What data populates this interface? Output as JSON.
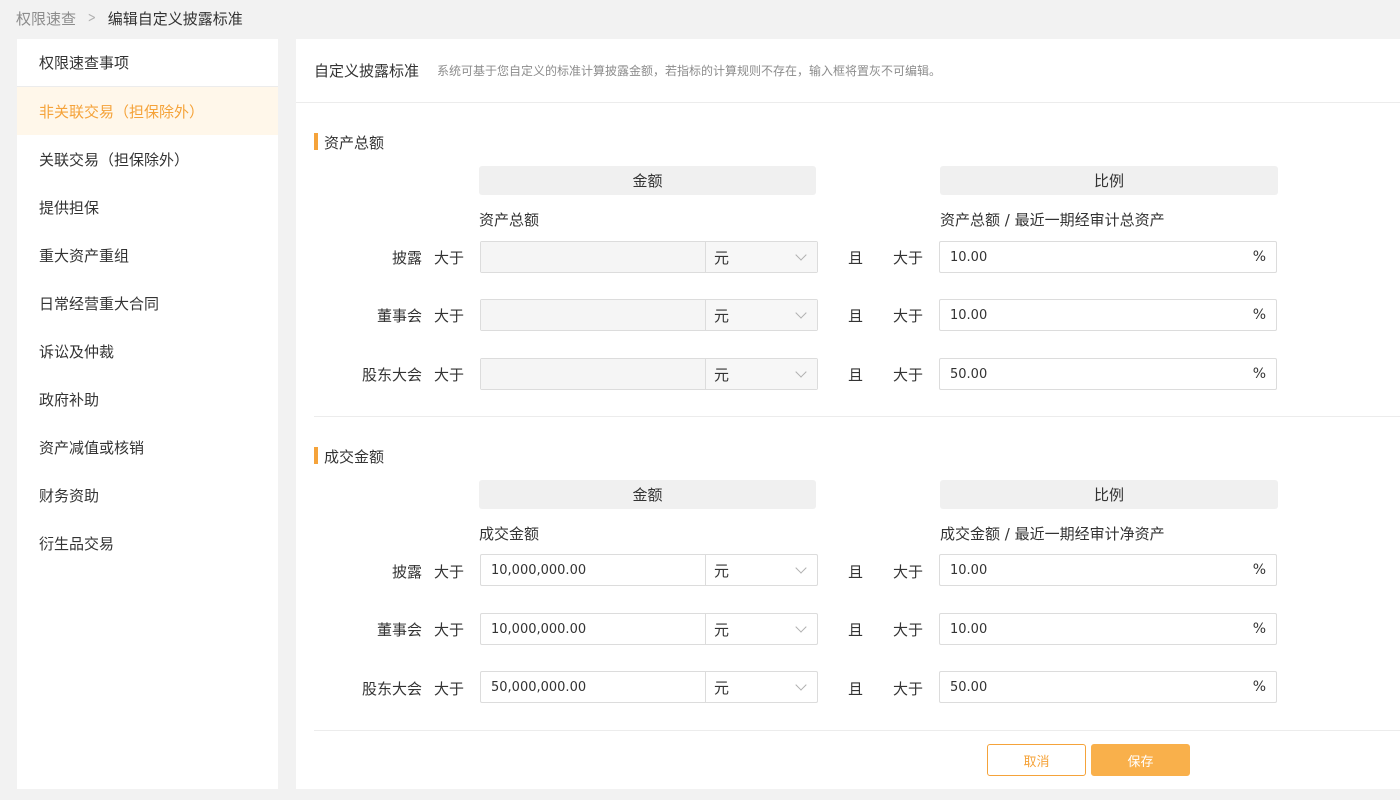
{
  "breadcrumb": {
    "parent": "权限速查",
    "current": "编辑自定义披露标准"
  },
  "sidebar": {
    "items": [
      {
        "label": "权限速查事项"
      },
      {
        "label": "非关联交易（担保除外）"
      },
      {
        "label": "关联交易（担保除外）"
      },
      {
        "label": "提供担保"
      },
      {
        "label": "重大资产重组"
      },
      {
        "label": "日常经营重大合同"
      },
      {
        "label": "诉讼及仲裁"
      },
      {
        "label": "政府补助"
      },
      {
        "label": "资产减值或核销"
      },
      {
        "label": "财务资助"
      },
      {
        "label": "衍生品交易"
      }
    ],
    "active_index": 1
  },
  "header": {
    "title": "自定义披露标准",
    "description": "系统可基于您自定义的标准计算披露金额，若指标的计算规则不存在，输入框将置灰不可编辑。"
  },
  "common": {
    "amount_col": "金额",
    "ratio_col": "比例",
    "greater": "大于",
    "and": "且",
    "percent": "%"
  },
  "sections": [
    {
      "title": "资产总额",
      "amount_label": "资产总额",
      "ratio_label": "资产总额 / 最近一期经审计总资产",
      "disabled": true,
      "rows": [
        {
          "label": "披露",
          "amount": "",
          "unit": "元",
          "ratio": "10.00"
        },
        {
          "label": "董事会",
          "amount": "",
          "unit": "元",
          "ratio": "10.00"
        },
        {
          "label": "股东大会",
          "amount": "",
          "unit": "元",
          "ratio": "50.00"
        }
      ]
    },
    {
      "title": "成交金额",
      "amount_label": "成交金额",
      "ratio_label": "成交金额 / 最近一期经审计净资产",
      "disabled": false,
      "rows": [
        {
          "label": "披露",
          "amount": "10,000,000.00",
          "unit": "元",
          "ratio": "10.00"
        },
        {
          "label": "董事会",
          "amount": "10,000,000.00",
          "unit": "元",
          "ratio": "10.00"
        },
        {
          "label": "股东大会",
          "amount": "50,000,000.00",
          "unit": "元",
          "ratio": "50.00"
        }
      ]
    }
  ],
  "actions": {
    "cancel": "取消",
    "save": "保存"
  },
  "colors": {
    "accent": "#f5a33a",
    "active_bg": "#fff7ea"
  }
}
